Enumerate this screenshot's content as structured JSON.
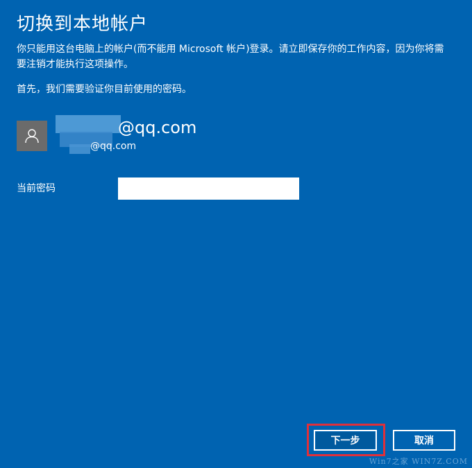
{
  "title": "切换到本地帐户",
  "description": "你只能用这台电脑上的帐户(而不能用 Microsoft 帐户)登录。请立即保存你的工作内容，因为你将需要注销才能执行这项操作。",
  "verify_text": "首先，我们需要验证你目前使用的密码。",
  "account": {
    "name": "@qq.com",
    "email": "@qq.com",
    "avatar_icon": "user-icon"
  },
  "password": {
    "label": "当前密码",
    "value": ""
  },
  "buttons": {
    "next": "下一步",
    "cancel": "取消"
  },
  "watermark": "Win7之家 WIN7Z.COM",
  "colors": {
    "background": "#0063b1",
    "highlight": "#e0303a"
  }
}
